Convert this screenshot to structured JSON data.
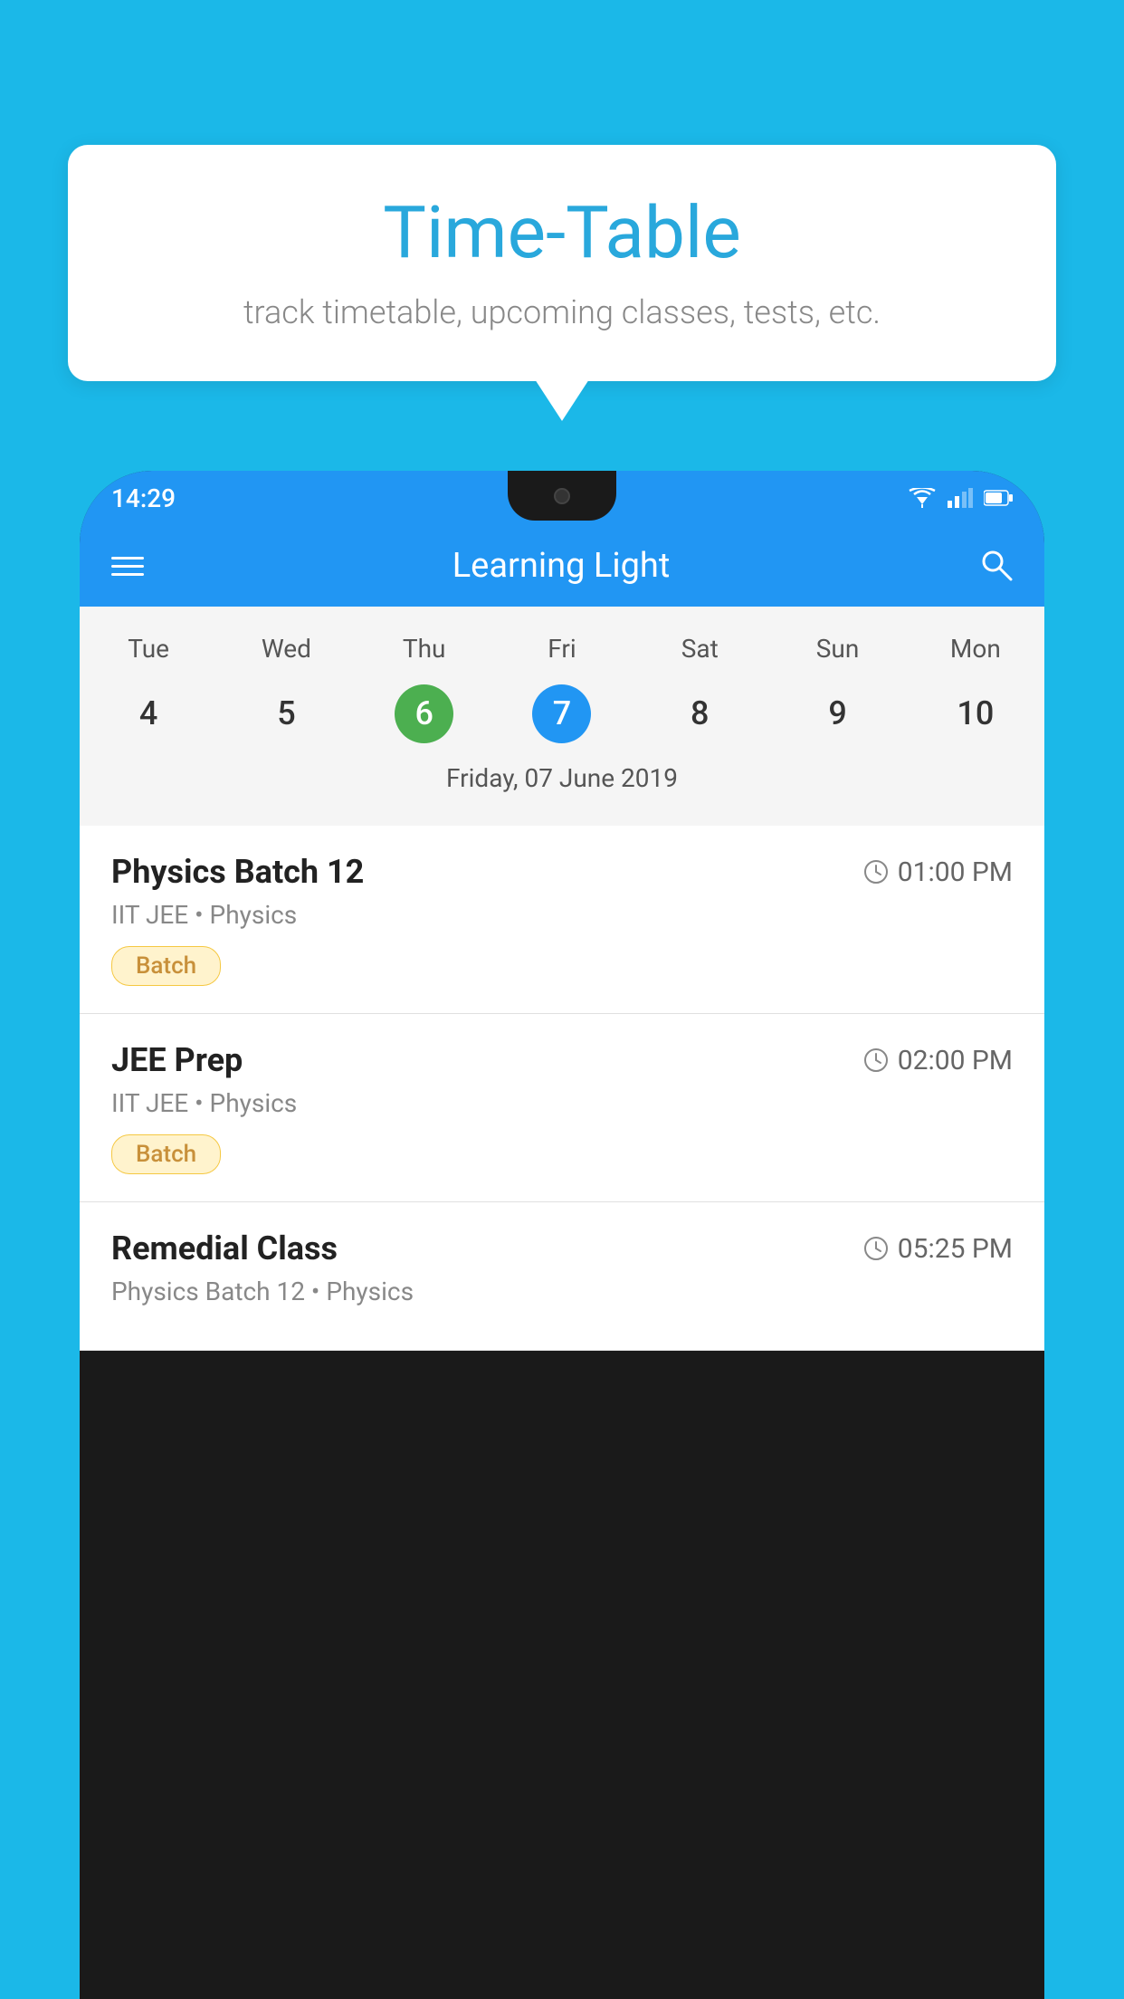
{
  "background_color": "#1BB8E8",
  "tooltip": {
    "title": "Time-Table",
    "subtitle": "track timetable, upcoming classes, tests, etc."
  },
  "phone": {
    "status_bar": {
      "time": "14:29"
    },
    "app_bar": {
      "title": "Learning Light",
      "menu_icon_label": "menu",
      "search_icon_label": "search"
    },
    "calendar": {
      "days": [
        "Tue",
        "Wed",
        "Thu",
        "Fri",
        "Sat",
        "Sun",
        "Mon"
      ],
      "dates": [
        {
          "num": "4",
          "state": "normal"
        },
        {
          "num": "5",
          "state": "normal"
        },
        {
          "num": "6",
          "state": "today"
        },
        {
          "num": "7",
          "state": "selected"
        },
        {
          "num": "8",
          "state": "normal"
        },
        {
          "num": "9",
          "state": "normal"
        },
        {
          "num": "10",
          "state": "normal"
        }
      ],
      "selected_label": "Friday, 07 June 2019"
    },
    "schedule": [
      {
        "title": "Physics Batch 12",
        "time": "01:00 PM",
        "subtitle": "IIT JEE • Physics",
        "badge": "Batch"
      },
      {
        "title": "JEE Prep",
        "time": "02:00 PM",
        "subtitle": "IIT JEE • Physics",
        "badge": "Batch"
      },
      {
        "title": "Remedial Class",
        "time": "05:25 PM",
        "subtitle": "Physics Batch 12 • Physics",
        "badge": null
      }
    ]
  }
}
